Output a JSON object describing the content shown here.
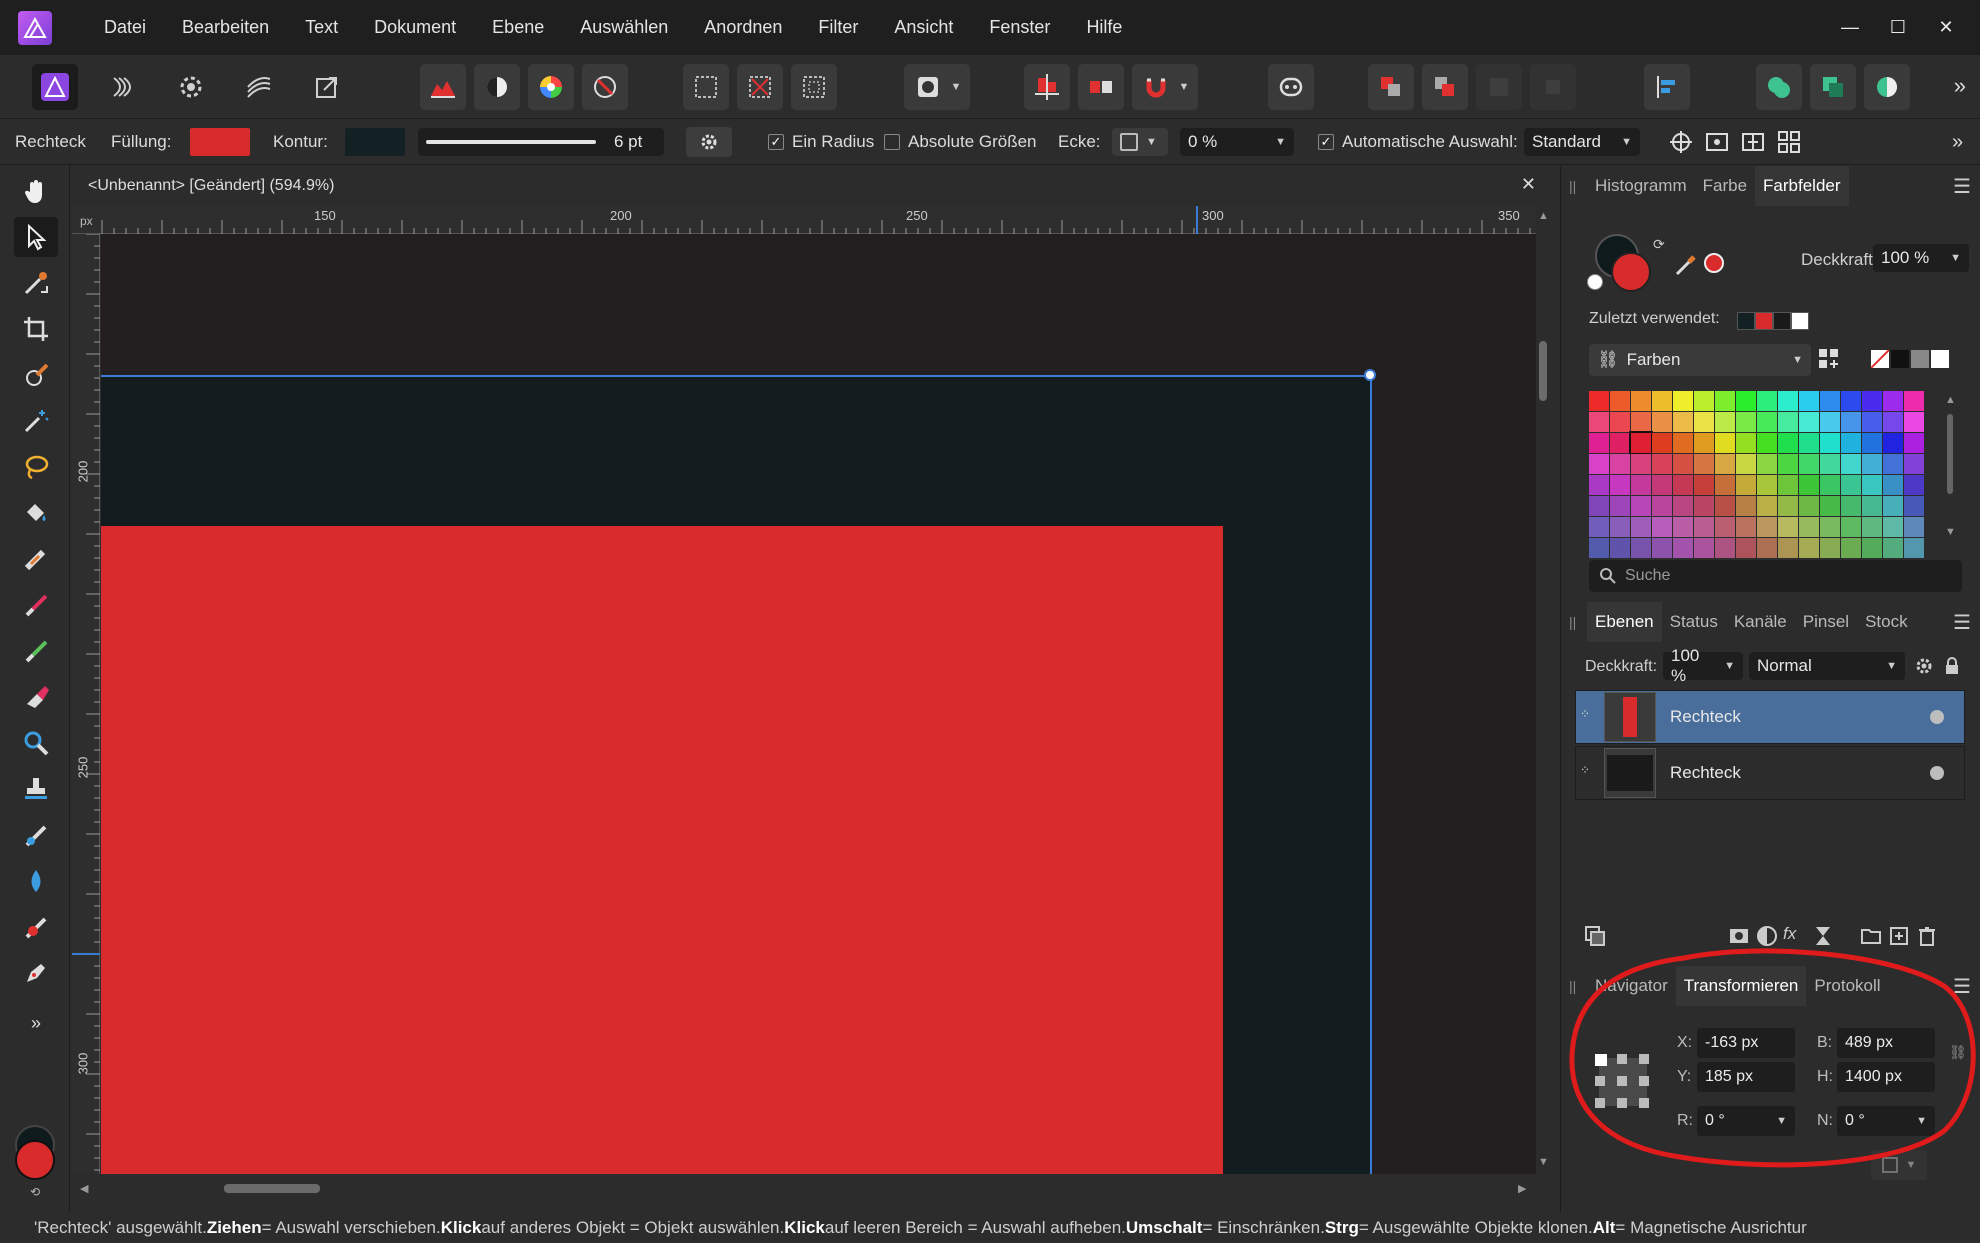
{
  "menu": [
    "Datei",
    "Bearbeiten",
    "Text",
    "Dokument",
    "Ebene",
    "Auswählen",
    "Anordnen",
    "Filter",
    "Ansicht",
    "Fenster",
    "Hilfe"
  ],
  "window_controls": [
    "—",
    "☐",
    "✕"
  ],
  "context": {
    "tool_name": "Rechteck",
    "fill_label": "Füllung:",
    "fill_color": "#d92b2b",
    "stroke_label": "Kontur:",
    "stroke_color": "#132024",
    "stroke_width": "6 pt",
    "single_radius": "Ein Radius",
    "single_radius_checked": true,
    "absolute_sizes": "Absolute Größen",
    "absolute_sizes_checked": false,
    "corner_label": "Ecke:",
    "corner_value": "0 %",
    "auto_select": "Automatische Auswahl:",
    "auto_select_checked": true,
    "auto_select_value": "Standard"
  },
  "document": {
    "title": "<Unbenannt> [Geändert] (594.9%)",
    "ruler_unit": "px",
    "ruler_top_labels": [
      "150",
      "200",
      "250",
      "300",
      "350"
    ],
    "ruler_left_labels": [
      "200",
      "250",
      "300"
    ]
  },
  "color_panel": {
    "tabs": [
      "Histogramm",
      "Farbe",
      "Farbfelder"
    ],
    "active_tab": "Farbfelder",
    "opacity_label": "Deckkraft:",
    "opacity_value": "100 %",
    "recent_label": "Zuletzt verwendet:",
    "recent_colors": [
      "#132024",
      "#d92b2b",
      "#1a1a1a",
      "#ffffff"
    ],
    "palette_name": "Farben",
    "search_placeholder": "Suche"
  },
  "layers_panel": {
    "tabs": [
      "Ebenen",
      "Status",
      "Kanäle",
      "Pinsel",
      "Stock"
    ],
    "active_tab": "Ebenen",
    "opacity_label": "Deckkraft:",
    "opacity_value": "100 %",
    "blend_mode": "Normal",
    "layers": [
      {
        "name": "Rechteck",
        "selected": true,
        "thumb_color": "#d92b2b"
      },
      {
        "name": "Rechteck",
        "selected": false,
        "thumb_color": "#1a1a1a"
      }
    ]
  },
  "transform_panel": {
    "tabs": [
      "Navigator",
      "Transformieren",
      "Protokoll"
    ],
    "active_tab": "Transformieren",
    "x_label": "X:",
    "x_value": "-163 px",
    "y_label": "Y:",
    "y_value": "185 px",
    "w_label": "B:",
    "w_value": "489 px",
    "h_label": "H:",
    "h_value": "1400 px",
    "r_label": "R:",
    "r_value": "0 °",
    "s_label": "N:",
    "s_value": "0 °"
  },
  "status": {
    "part1": "'Rechteck' ausgewählt. ",
    "k1": "Ziehen",
    "t1": " = Auswahl verschieben. ",
    "k2": "Klick",
    "t2": " auf anderes Objekt = Objekt auswählen. ",
    "k3": "Klick",
    "t3": " auf leeren Bereich = Auswahl aufheben. ",
    "k4": "Umschalt",
    "t4": " = Einschränken. ",
    "k5": "Strg",
    "t5": " = Ausgewählte Objekte klonen. ",
    "k6": "Alt",
    "t6": " = Magnetische Ausrichtur"
  },
  "colors": {
    "accent": "#3b7bd6",
    "selection_row": "#4a6e9c",
    "annotation": "#e01b1b"
  }
}
